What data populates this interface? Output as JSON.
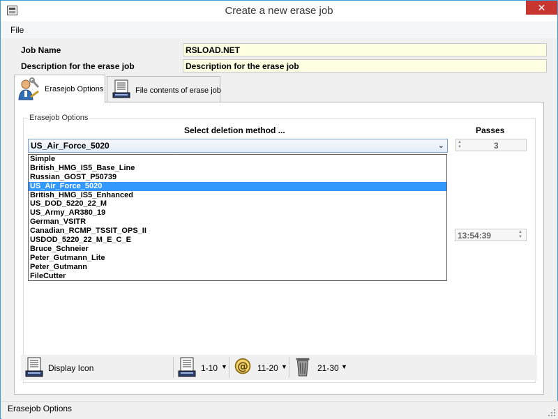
{
  "window": {
    "title": "Create a new erase job",
    "close_glyph": "✕"
  },
  "menu": {
    "file_label": "File"
  },
  "form": {
    "job_name_label": "Job Name",
    "job_name_value": "RSLOAD.NET",
    "description_label": "Description for the erase job",
    "description_value": "Description for the erase job"
  },
  "tabs": [
    {
      "label": "Erasejob Options",
      "icon": "user-tools-icon",
      "active": true
    },
    {
      "label": "File contents of erase job",
      "icon": "document-stack-icon",
      "active": false
    }
  ],
  "options": {
    "group_title": "Erasejob Options",
    "select_heading": "Select deletion method ...",
    "passes_heading": "Passes",
    "selected_method": "US_Air_Force_5020",
    "methods": [
      "Simple",
      "British_HMG_IS5_Base_Line",
      "Russian_GOST_P50739",
      "US_Air_Force_5020",
      "British_HMG_IS5_Enhanced",
      "US_DOD_5220_22_M",
      "US_Army_AR380_19",
      "German_VSITR",
      "Canadian_RCMP_TSSIT_OPS_II",
      "USDOD_5220_22_M_E_C_E",
      "Bruce_Schneier",
      "Peter_Gutmann_Lite",
      "Peter_Gutmann",
      "FileCutter"
    ],
    "passes_value": "3",
    "time_value": "13:54:39"
  },
  "toolbar": {
    "display_icon_label": "Display Icon",
    "range1_label": "1-10",
    "range2_label": "11-20",
    "range3_label": "21-30"
  },
  "status": {
    "text": "Erasejob Options"
  },
  "colors": {
    "selection": "#3399ff",
    "field_yellow": "#ffffe1",
    "close_red": "#c7372f"
  }
}
